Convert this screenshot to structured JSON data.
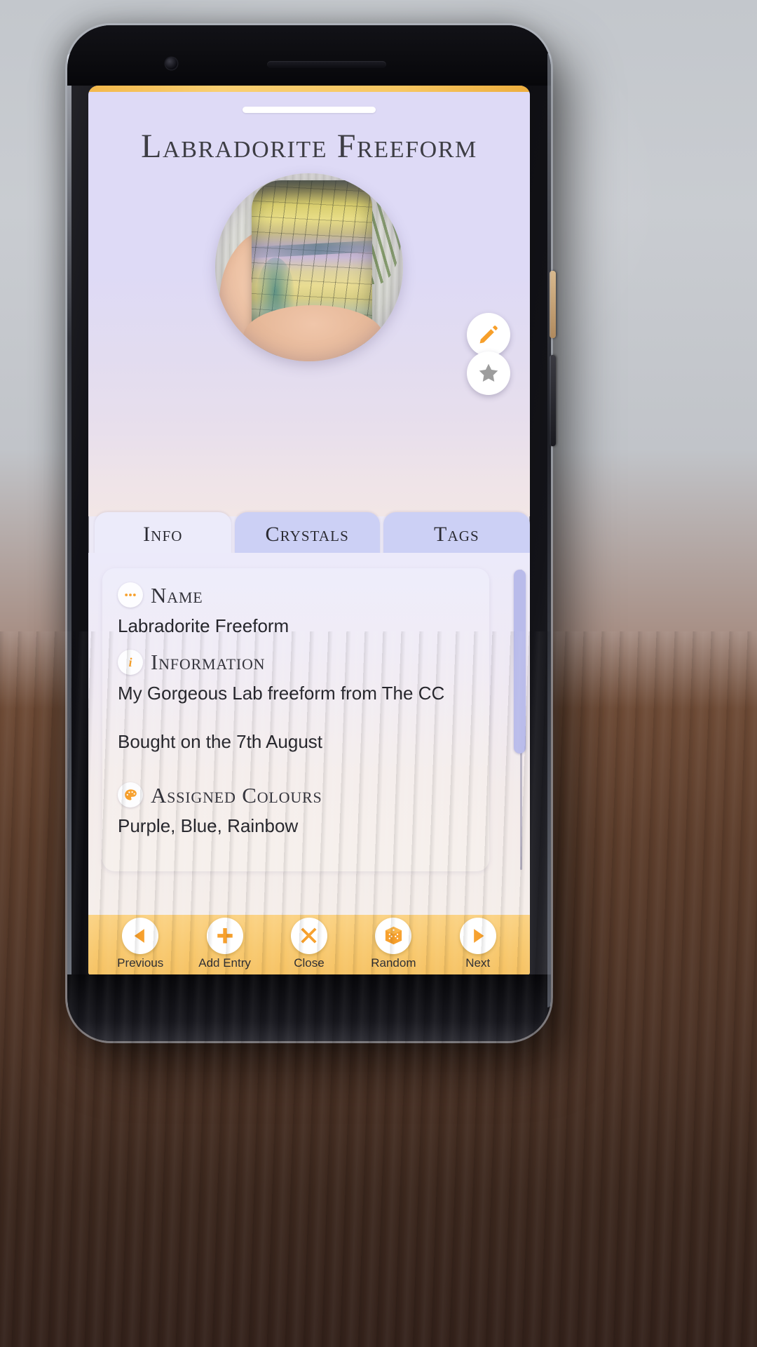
{
  "app": {
    "title": "Labradorite Freeform",
    "accent_orange": "#f79f2a",
    "accent_periwinkle": "#ccd0f5",
    "nav_bar_color": "#f8c96f"
  },
  "hero": {
    "photo_alt": "labradorite-freeform-photo",
    "edit_icon": "pencil-icon",
    "favourite_icon": "star-icon"
  },
  "tabs": [
    {
      "label": "Info",
      "active": true
    },
    {
      "label": "Crystals",
      "active": false
    },
    {
      "label": "Tags",
      "active": false
    }
  ],
  "info_card": {
    "fields": [
      {
        "icon": "dots-icon",
        "label": "Name",
        "value": "Labradorite Freeform"
      },
      {
        "icon": "info-icon",
        "label": "Information",
        "value": "My Gorgeous Lab freeform from The CC",
        "value2": "Bought on the 7th August"
      },
      {
        "icon": "palette-icon",
        "label": "Assigned Colours",
        "value": "Purple, Blue, Rainbow"
      }
    ]
  },
  "bottom_nav": [
    {
      "label": "Previous",
      "icon": "play-left-icon"
    },
    {
      "label": "Add Entry",
      "icon": "plus-icon"
    },
    {
      "label": "Close",
      "icon": "cross-icon"
    },
    {
      "label": "Random",
      "icon": "dice-icon"
    },
    {
      "label": "Next",
      "icon": "play-right-icon"
    }
  ]
}
